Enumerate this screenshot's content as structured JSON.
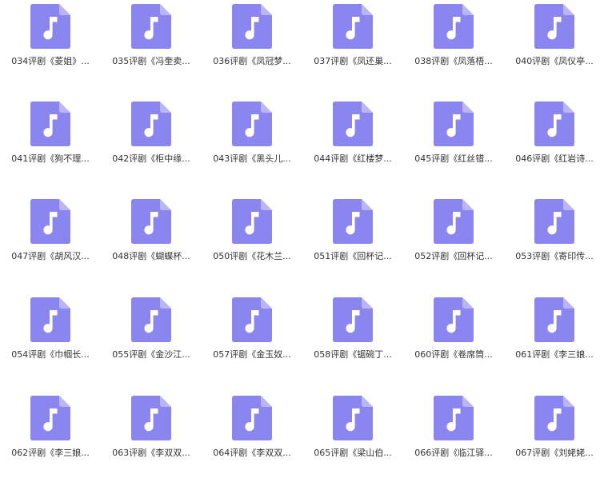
{
  "colors": {
    "icon_fill": "#8b85f0",
    "icon_fold": "#b9b5f7",
    "note": "#ffffff",
    "label_text": "#333333"
  },
  "icon": "music-note-file-icon",
  "files": [
    {
      "label": "034评剧《菱姐》..."
    },
    {
      "label": "035评剧《冯奎卖..."
    },
    {
      "label": "036评剧《凤冠梦..."
    },
    {
      "label": "037评剧《凤还巢..."
    },
    {
      "label": "038评剧《凤落梧..."
    },
    {
      "label": "040评剧《凤仪亭..."
    },
    {
      "label": "041评剧《狗不理..."
    },
    {
      "label": "042评剧《柜中缘..."
    },
    {
      "label": "043评剧《黑头儿..."
    },
    {
      "label": "044评剧《红楼梦..."
    },
    {
      "label": "045评剧《红丝错..."
    },
    {
      "label": "046评剧《红岩诗..."
    },
    {
      "label": "047评剧《胡风汉..."
    },
    {
      "label": "048评剧《蝴蝶杯..."
    },
    {
      "label": "050评剧《花木兰..."
    },
    {
      "label": "051评剧《回杯记..."
    },
    {
      "label": "052评剧《回杯记..."
    },
    {
      "label": "053评剧《寄印传..."
    },
    {
      "label": "054评剧《巾帼长..."
    },
    {
      "label": "055评剧《金沙江..."
    },
    {
      "label": "057评剧《金玉奴..."
    },
    {
      "label": "058评剧《锯碗丁..."
    },
    {
      "label": "060评剧《卷席筒..."
    },
    {
      "label": "061评剧《李三娘..."
    },
    {
      "label": "062评剧《李三娘..."
    },
    {
      "label": "063评剧《李双双..."
    },
    {
      "label": "064评剧《李双双..."
    },
    {
      "label": "065评剧《梁山伯..."
    },
    {
      "label": "066评剧《临江驿..."
    },
    {
      "label": "067评剧《刘姥姥..."
    }
  ]
}
